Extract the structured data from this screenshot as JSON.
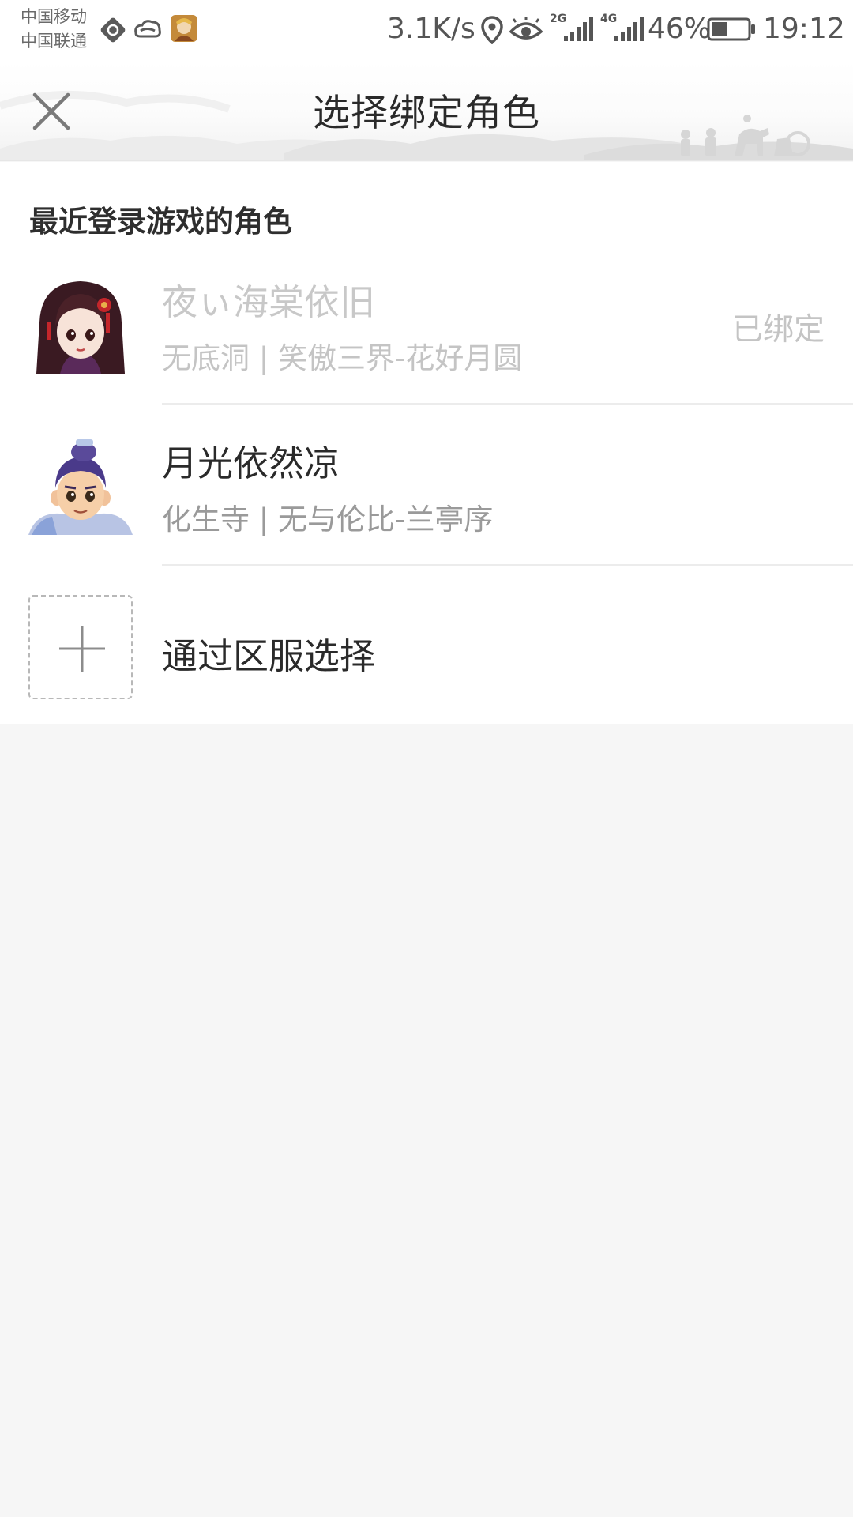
{
  "status_bar": {
    "carrier_1": "中国移动",
    "carrier_2": "中国联通",
    "net_speed": "3.1K/s",
    "net_tag_1": "2G",
    "net_tag_2": "4G",
    "battery": "46%",
    "battery_level": 0.46,
    "time": "19:12",
    "icons": [
      "nav-diamond-icon",
      "cloud-app-icon",
      "game-app-icon",
      "location-icon",
      "eye-icon",
      "signal-2g-icon",
      "signal-4g-icon",
      "battery-icon"
    ]
  },
  "header": {
    "title": "选择绑定角色",
    "close_icon": "close-icon"
  },
  "recent": {
    "section_title": "最近登录游戏的角色",
    "roles": [
      {
        "name": "夜ぃ海棠依旧",
        "server": "无底洞 | 笑傲三界-花好月圆",
        "status": "已绑定"
      },
      {
        "name": "月光依然凉",
        "server": "化生寺 | 无与伦比-兰亭序",
        "status": ""
      }
    ]
  },
  "add_by_server": {
    "label": "通过区服选择",
    "icon": "plus-icon"
  },
  "colors": {
    "page_bg": "#f6f6f6",
    "card_bg": "#ffffff",
    "primary_text": "#2a2a2a",
    "disabled_text": "#c8c8c8",
    "secondary_text": "#9a9a9a"
  }
}
